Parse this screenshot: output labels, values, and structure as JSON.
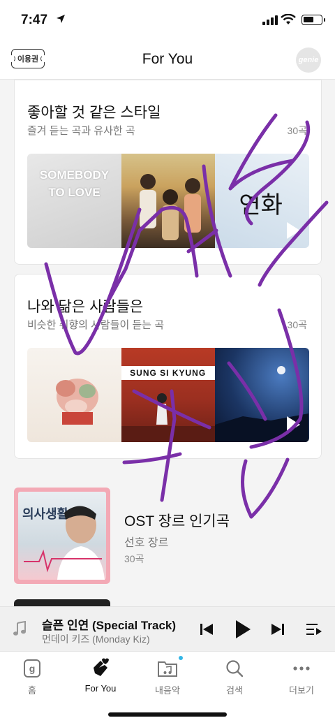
{
  "status": {
    "time": "7:47"
  },
  "header": {
    "ticket_label": "이용권",
    "title": "For You",
    "avatar_text": "genie"
  },
  "cards": [
    {
      "title": "좋아할 것 같은 스타일",
      "subtitle": "즐겨 듣는 곡과 유사한 곡",
      "count": "30곡",
      "cover_texts": [
        "SOMEBODY TO LOVE",
        "연화"
      ]
    },
    {
      "title": "나와 닮은 사람들은",
      "subtitle": "비슷한 취향의 사람들이 듣는 곡",
      "count": "30곡",
      "cover_texts": [
        "SUNG SI KYUNG"
      ]
    }
  ],
  "ost": {
    "title": "OST 장르 인기곡",
    "subtitle": "선호 장르",
    "count": "30곡",
    "cover_text": "의사생활"
  },
  "player": {
    "song": "슬픈 인연 (Special Track)",
    "artist": "먼데이 키즈 (Monday Kiz)"
  },
  "tabs": [
    {
      "label": "홈",
      "icon": "home-g-icon"
    },
    {
      "label": "For You",
      "icon": "heart-hand-icon"
    },
    {
      "label": "내음악",
      "icon": "music-folder-icon"
    },
    {
      "label": "검색",
      "icon": "search-icon"
    },
    {
      "label": "더보기",
      "icon": "more-icon"
    }
  ],
  "colors": {
    "accent": "#33b6e6",
    "scribble": "#7a2fa8"
  }
}
